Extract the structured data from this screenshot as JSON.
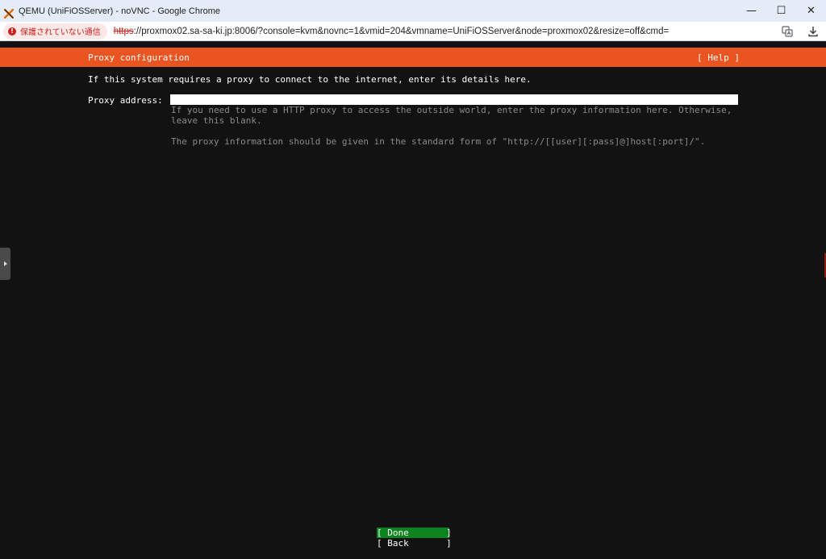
{
  "window": {
    "title": "QEMU (UniFiOSServer) - noVNC - Google Chrome",
    "minimize_glyph": "—",
    "maximize_glyph": "☐",
    "close_glyph": "✕"
  },
  "addressbar": {
    "security_label": "保護されていない通信",
    "url_scheme": "https",
    "url_rest": "://proxmox02.sa-sa-ki.jp:8006/?console=kvm&novnc=1&vmid=204&vmname=UniFiOSServer&node=proxmox02&resize=off&cmd=",
    "icons": [
      "translate-icon",
      "download-icon"
    ]
  },
  "installer": {
    "header_title": "Proxy configuration",
    "help_label": "[ Help ]",
    "intro": "If this system requires a proxy to connect to the internet, enter its details here.",
    "field_label": "Proxy address:",
    "field_value": "",
    "help_lines": [
      "If you need to use a HTTP proxy to access the outside world, enter the proxy information here. Otherwise,",
      "leave this blank.",
      "The proxy information should be given in the standard form of \"http://[[user][:pass]@]host[:port]/\"."
    ],
    "done_label": "[ Done       ]",
    "back_label": "[ Back       ]"
  },
  "colors": {
    "header": "#e95420",
    "done_button": "#0e8420",
    "console_bg": "#121212",
    "help_text": "#8a8a8a"
  }
}
